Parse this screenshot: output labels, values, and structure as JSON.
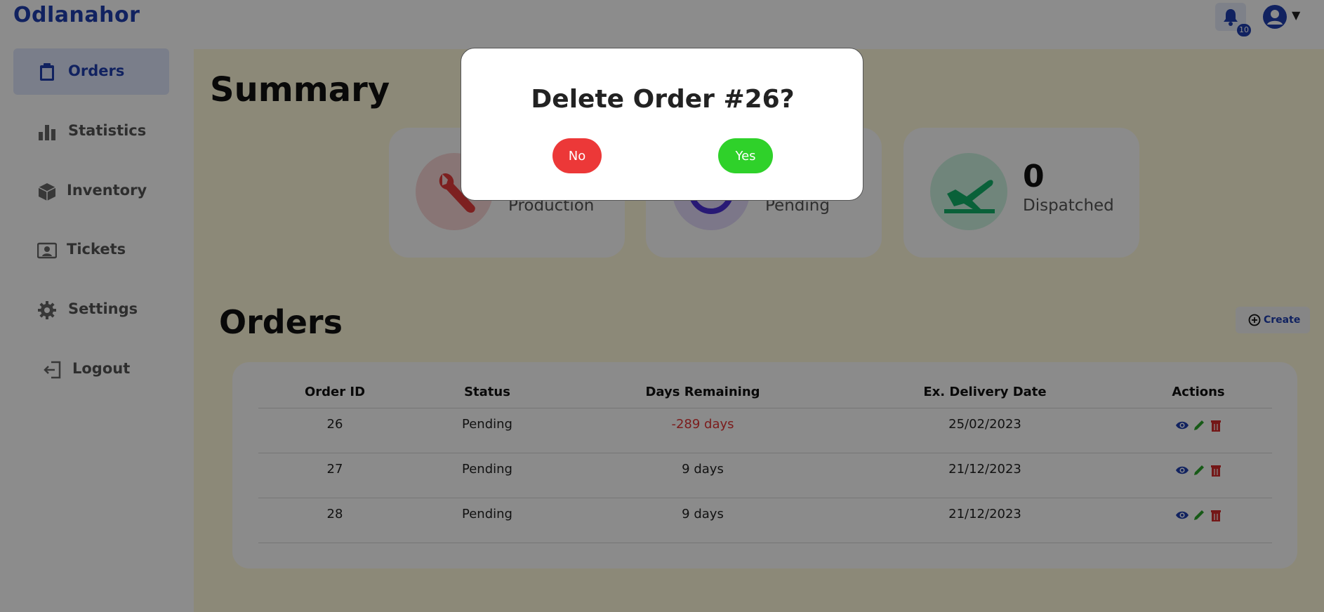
{
  "app": {
    "brand": "Odlanahor"
  },
  "header": {
    "notification_count": "10"
  },
  "sidebar": {
    "items": [
      {
        "label": "Orders",
        "icon": "clipboard-icon",
        "active": true
      },
      {
        "label": "Statistics",
        "icon": "bar-chart-icon",
        "active": false
      },
      {
        "label": "Inventory",
        "icon": "box-icon",
        "active": false
      },
      {
        "label": "Tickets",
        "icon": "ticket-icon",
        "active": false
      },
      {
        "label": "Settings",
        "icon": "gear-icon",
        "active": false
      },
      {
        "label": "Logout",
        "icon": "logout-icon",
        "active": false
      }
    ]
  },
  "summary": {
    "title": "Summary",
    "cards": [
      {
        "label": "Production",
        "value": "",
        "icon": "wrench-icon"
      },
      {
        "label": "Pending",
        "value": "",
        "icon": "clock-icon"
      },
      {
        "label": "Dispatched",
        "value": "0",
        "icon": "airplane-icon"
      }
    ]
  },
  "orders": {
    "title": "Orders",
    "create_label": "Create",
    "columns": [
      "Order ID",
      "Status",
      "Days Remaining",
      "Ex. Delivery Date",
      "Actions"
    ],
    "rows": [
      {
        "id": "26",
        "status": "Pending",
        "days": "-289 days",
        "date": "25/02/2023"
      },
      {
        "id": "27",
        "status": "Pending",
        "days": "9 days",
        "date": "21/12/2023"
      },
      {
        "id": "28",
        "status": "Pending",
        "days": "9 days",
        "date": "21/12/2023"
      }
    ]
  },
  "modal": {
    "title": "Delete Order #26?",
    "no_label": "No",
    "yes_label": "Yes"
  },
  "colors": {
    "accent": "#1f3fb0",
    "danger": "#ec3838",
    "success": "#2fd12a",
    "main_bg": "#fff9da"
  }
}
